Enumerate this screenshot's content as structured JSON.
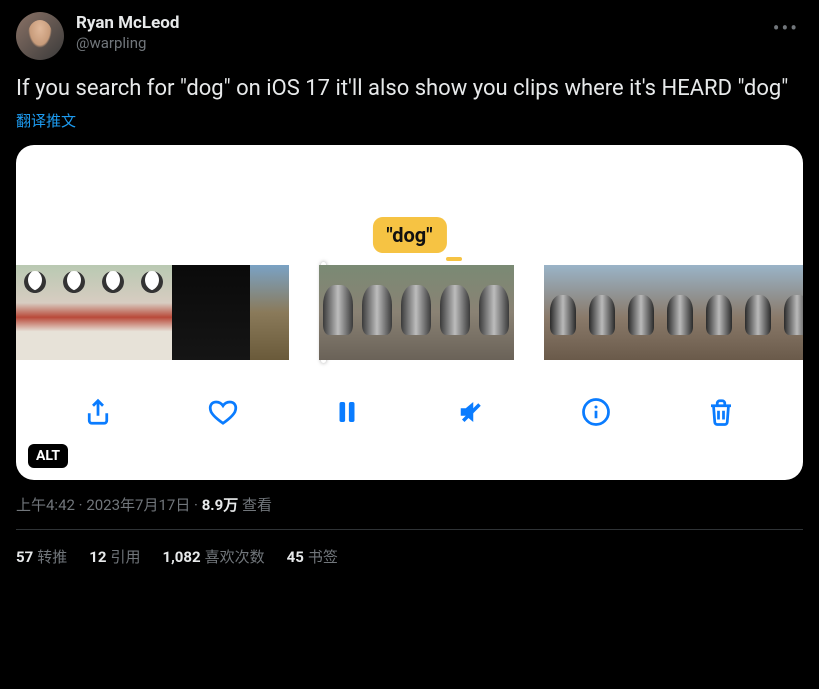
{
  "author": {
    "display_name": "Ryan McLeod",
    "handle": "@warpling"
  },
  "tweet_text": "If you search for \"dog\" on iOS 17 it'll also show you clips where it's HEARD \"dog\"",
  "translate_label": "翻译推文",
  "media": {
    "highlight_label": "\"dog\"",
    "alt_badge": "ALT"
  },
  "meta": {
    "time": "上午4:42",
    "separator1": " · ",
    "date": "2023年7月17日",
    "separator2": " · ",
    "views_count": "8.9万",
    "views_label": " 查看"
  },
  "stats": {
    "retweets": {
      "count": "57",
      "label": "转推"
    },
    "quotes": {
      "count": "12",
      "label": "引用"
    },
    "likes": {
      "count": "1,082",
      "label": "喜欢次数"
    },
    "bookmarks": {
      "count": "45",
      "label": "书签"
    }
  }
}
